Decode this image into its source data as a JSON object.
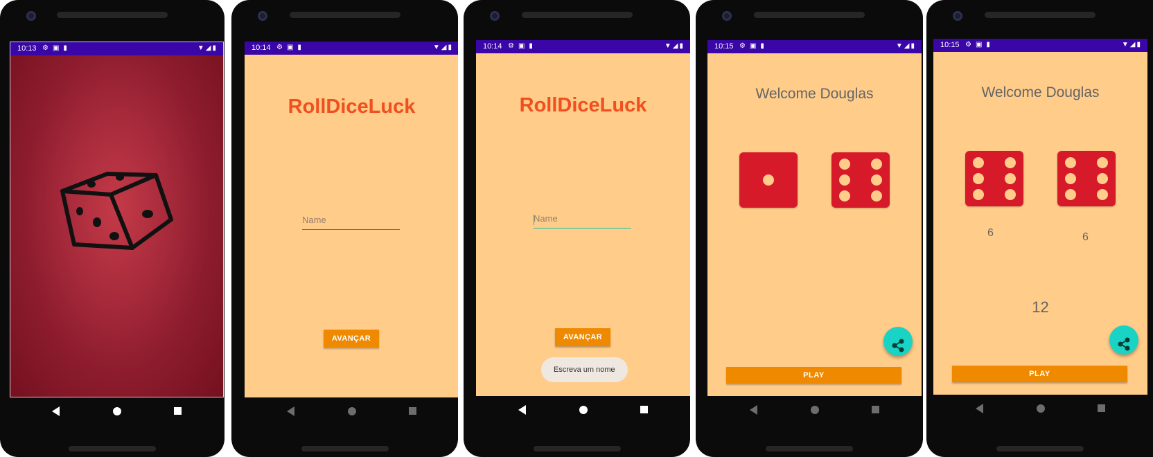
{
  "colors": {
    "status_bar": "#3a06a8",
    "screen_background": "#ffcc8a",
    "title_orange": "#f0501f",
    "button_orange": "#ef8a00",
    "dice_red": "#d71a2a",
    "fab_teal": "#19d3c4",
    "text_gray": "#646464"
  },
  "screens": [
    {
      "status_time": "10:13",
      "image": "dice-icon"
    },
    {
      "status_time": "10:14",
      "app_title": "RollDiceLuck",
      "name_placeholder": "Name",
      "next_button": "AVANÇAR"
    },
    {
      "status_time": "10:14",
      "app_title": "RollDiceLuck",
      "name_placeholder": "Name",
      "next_button": "AVANÇAR",
      "toast": "Escreva um nome"
    },
    {
      "status_time": "10:15",
      "welcome": "Welcome Douglas",
      "dice_faces": [
        1,
        6
      ],
      "play_button": "PLAY",
      "fab_icon": "share-icon"
    },
    {
      "status_time": "10:15",
      "welcome": "Welcome Douglas",
      "dice_faces": [
        6,
        6
      ],
      "dice_values": [
        "6",
        "6"
      ],
      "total": "12",
      "play_button": "PLAY",
      "fab_icon": "share-icon"
    }
  ]
}
